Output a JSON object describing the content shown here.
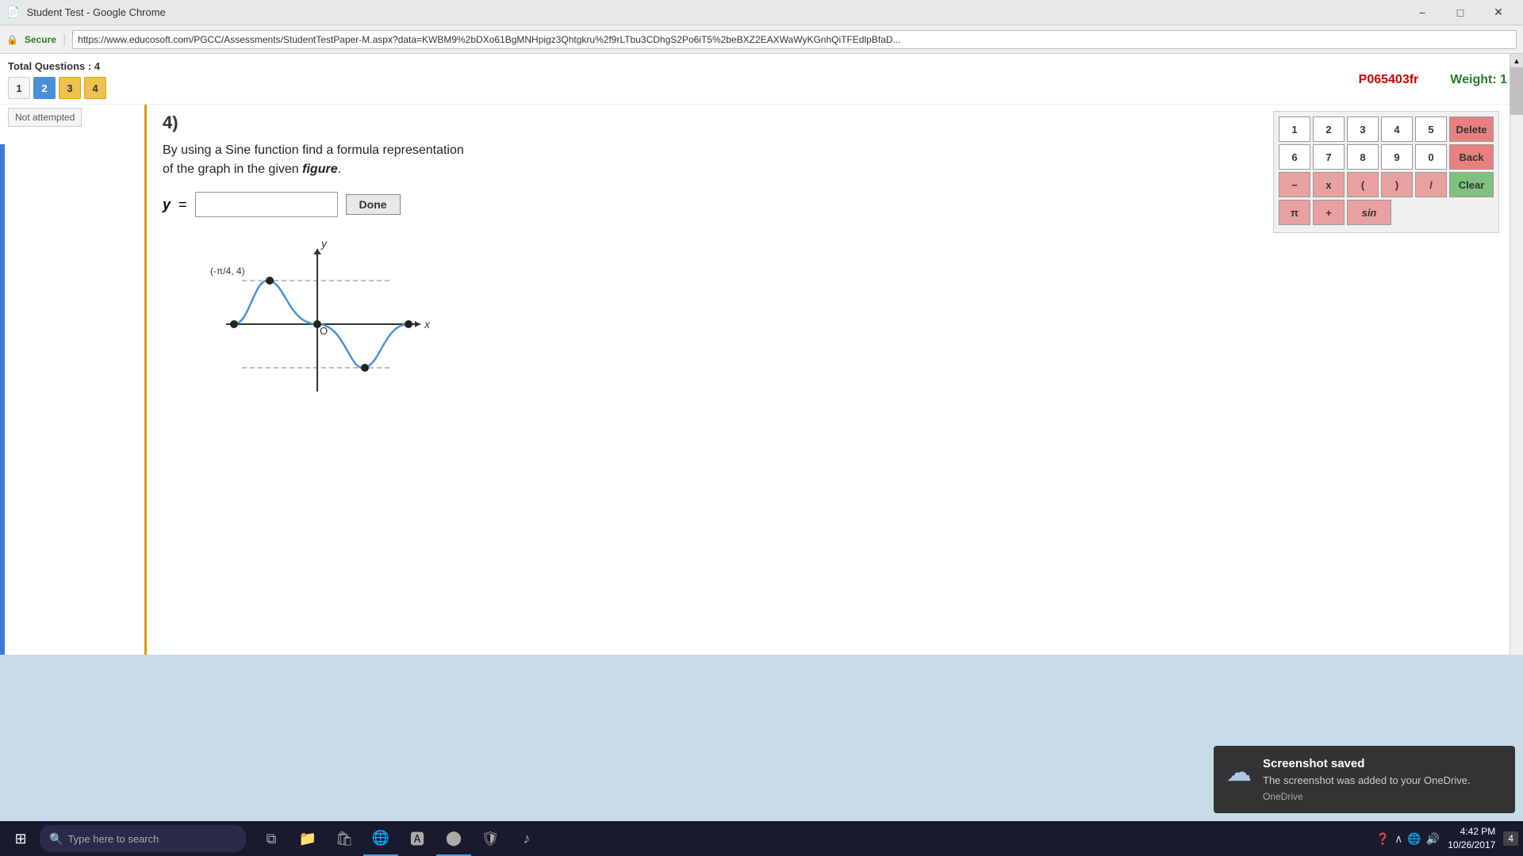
{
  "titleBar": {
    "title": "Student Test - Google Chrome",
    "icon": "📄",
    "minimize": "−",
    "maximize": "□",
    "close": "✕"
  },
  "addressBar": {
    "secure": "Secure",
    "url": "https://www.educosoft.com/PGCC/Assessments/StudentTestPaper-M.aspx?data=KWBM9%2bDXo61BgMNHpigz3Qhtgkru%2f9rLTbu3CDhgS2Po6iT5%2beBXZ2EAXWaWyKGnhQiTFEdlpBfaD..."
  },
  "header": {
    "totalLabel": "Total Questions : 4",
    "navButtons": [
      "1",
      "2",
      "3",
      "4"
    ],
    "activeButton": 1,
    "problemId": "P065403fr",
    "weightLabel": "Weight:",
    "weightValue": "1"
  },
  "sidebar": {
    "notAttempted": "Not attempted"
  },
  "question": {
    "number": "4)",
    "text1": "By using a Sine function find a formula representation",
    "text2": "of the graph in  the given",
    "textItalic": "figure",
    "textEnd": ".",
    "yLabel": "y",
    "equals": "=",
    "doneBtnLabel": "Done"
  },
  "calculator": {
    "buttons": [
      [
        "1",
        "2",
        "3",
        "4",
        "5",
        "Delete"
      ],
      [
        "6",
        "7",
        "8",
        "9",
        "0",
        "Back"
      ],
      [
        "−",
        "x",
        "(",
        ")",
        "/",
        "Clear"
      ],
      [
        "π",
        "+",
        "sin"
      ]
    ]
  },
  "graph": {
    "point1Label": "(-π/4, 4)",
    "xAxisLabel": "x",
    "yAxisLabel": "y",
    "originLabel": "O"
  },
  "taskbar": {
    "searchPlaceholder": "Type here to search",
    "clock": {
      "time": "4:42 PM",
      "date": "10/26/2017"
    },
    "notification": "4"
  },
  "toast": {
    "title": "Screenshot saved",
    "body": "The screenshot was added to your OneDrive.",
    "source": "OneDrive"
  }
}
